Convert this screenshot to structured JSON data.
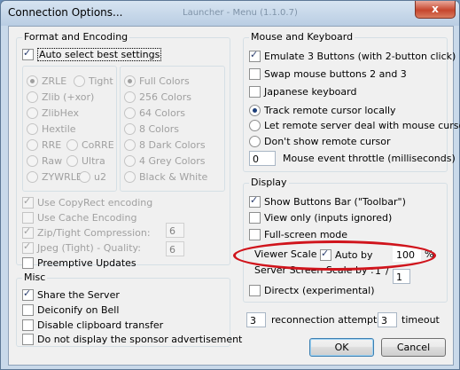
{
  "window": {
    "title": "Connection Options...",
    "ghost_title": "Launcher - Menu (1.1.0.7)",
    "close_glyph": "x"
  },
  "format": {
    "title": "Format and Encoding",
    "auto_select": "Auto select best settings",
    "encodings": {
      "zrle": "ZRLE",
      "tight": "Tight",
      "zlib": "Zlib (+xor)",
      "zlibhex": "ZlibHex",
      "hextile": "Hextile",
      "rre": "RRE",
      "corre": "CoRRE",
      "raw": "Raw",
      "ultra": "Ultra",
      "zywrle": "ZYWRLE",
      "u2": "u2"
    },
    "colors": [
      "Full Colors",
      "256 Colors",
      "64 Colors",
      "8 Colors",
      "8 Dark Colors",
      "4 Grey Colors",
      "Black & White"
    ],
    "copyrect": "Use CopyRect encoding",
    "cache": "Use Cache Encoding",
    "zip": "Zip/Tight Compression:",
    "zip_value": "6",
    "jpeg": "Jpeg (Tight) - Quality:",
    "jpeg_value": "6",
    "preemptive": "Preemptive Updates"
  },
  "misc": {
    "title": "Misc",
    "share": "Share the Server",
    "deiconify": "Deiconify on Bell",
    "clipboard": "Disable clipboard transfer",
    "sponsor": "Do not display the sponsor advertisement"
  },
  "mouse": {
    "title": "Mouse and Keyboard",
    "emulate": "Emulate 3 Buttons (with 2-button click)",
    "swap": "Swap mouse buttons 2 and 3",
    "japanese": "Japanese keyboard",
    "track": "Track remote cursor locally",
    "let_remote": "Let remote server deal with mouse cursor",
    "dont_show": "Don't show remote cursor",
    "throttle_value": "0",
    "throttle_label": "Mouse event throttle (milliseconds)"
  },
  "display": {
    "title": "Display",
    "show_buttons": "Show Buttons Bar (\"Toolbar\")",
    "view_only": "View only (inputs ignored)",
    "fullscreen": "Full-screen mode",
    "viewer_scale": "Viewer Scale :",
    "auto_by": "Auto by",
    "scale_value": "100",
    "percent": "%",
    "server_scale": "Server Screen Scale by :",
    "server_scale_left": "1",
    "slash": "/",
    "server_scale_value": "1",
    "directx": "Directx (experimental)"
  },
  "reconnect": {
    "attempts_value": "3",
    "attempts_label": "reconnection attempts",
    "timeout_value": "3",
    "timeout_label": "timeout"
  },
  "buttons": {
    "ok": "OK",
    "cancel": "Cancel"
  },
  "annotation_color": "#d0141c"
}
